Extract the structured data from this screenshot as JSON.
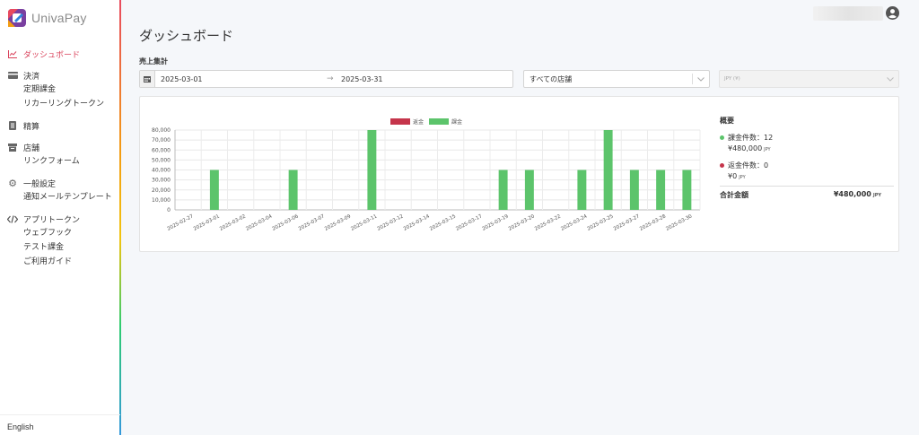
{
  "app": {
    "brand": "UnivaPay",
    "language": "English"
  },
  "sidebar": {
    "groups": [
      {
        "label": "ダッシュボード",
        "icon": "chart-icon",
        "active": true,
        "subs": []
      },
      {
        "label": "決済",
        "icon": "credit-card-icon",
        "subs": [
          "定期課金",
          "リカーリングトークン"
        ]
      },
      {
        "label": "精算",
        "icon": "document-icon",
        "subs": []
      },
      {
        "label": "店舗",
        "icon": "store-icon",
        "subs": [
          "リンクフォーム"
        ]
      },
      {
        "label": "一般設定",
        "icon": "gear-icon",
        "subs": [
          "通知メールテンプレート"
        ]
      },
      {
        "label": "アプリトークン",
        "icon": "code-icon",
        "subs": [
          "ウェブフック",
          "テスト課金",
          "ご利用ガイド"
        ]
      }
    ]
  },
  "page": {
    "title": "ダッシュボード",
    "section": "売上集計"
  },
  "filters": {
    "date_start": "2025-03-01",
    "date_end": "2025-03-31",
    "store": "すべての店舗",
    "currency": "JPY (¥)"
  },
  "summary": {
    "title": "概要",
    "charge_count_label": "課金件数：12",
    "charge_amount": "¥480,000",
    "refund_count_label": "返金件数：0",
    "refund_amount": "¥0",
    "unit": "JPY",
    "total_label": "合計金額",
    "total_value": "¥480,000"
  },
  "colors": {
    "accent": "#d9415a",
    "charge": "#5cc46b",
    "refund": "#c5354b"
  },
  "chart_data": {
    "type": "bar",
    "legend": [
      "返金",
      "課金"
    ],
    "legend_position": "top",
    "grid": true,
    "ylim": [
      0,
      80000
    ],
    "y_ticks": [
      "0",
      "10,000",
      "20,000",
      "30,000",
      "40,000",
      "50,000",
      "60,000",
      "70,000",
      "80,000"
    ],
    "categories": [
      "2025-02-27",
      "2025-03-01",
      "2025-03-02",
      "2025-03-04",
      "2025-03-06",
      "2025-03-07",
      "2025-03-09",
      "2025-03-11",
      "2025-03-12",
      "2025-03-14",
      "2025-03-15",
      "2025-03-17",
      "2025-03-19",
      "2025-03-20",
      "2025-03-22",
      "2025-03-24",
      "2025-03-25",
      "2025-03-27",
      "2025-03-28",
      "2025-03-30"
    ],
    "x_tick_labels": [
      "2025-02-27",
      "2025-03-01",
      "2025-03-02",
      "2025-03-04",
      "2025-03-06",
      "2025-03-07",
      "2025-03-09",
      "2025-03-11",
      "2025-03-12",
      "2025-03-14",
      "2025-03-15",
      "2025-03-17",
      "2025-03-19",
      "2025-03-20",
      "2025-03-22",
      "2025-03-24",
      "2025-03-25",
      "2025-03-27",
      "2025-03-28",
      "2025-03-30"
    ],
    "series": [
      {
        "name": "返金",
        "values": [
          0,
          0,
          0,
          0,
          0,
          0,
          0,
          0,
          0,
          0,
          0,
          0,
          0,
          0,
          0,
          0,
          0,
          0,
          0,
          0
        ]
      },
      {
        "name": "課金",
        "values": [
          0,
          40000,
          0,
          0,
          40000,
          0,
          0,
          80000,
          0,
          0,
          0,
          0,
          40000,
          40000,
          0,
          40000,
          80000,
          40000,
          40000,
          40000
        ]
      }
    ]
  }
}
